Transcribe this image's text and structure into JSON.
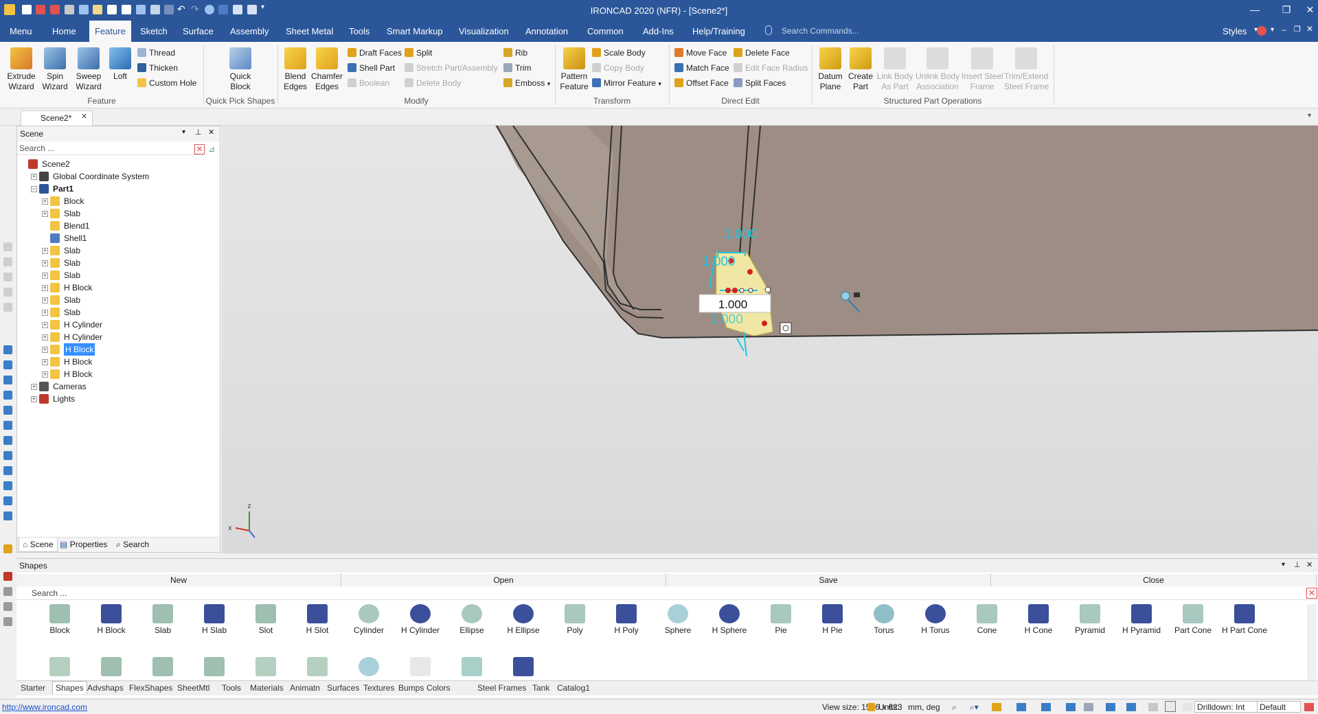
{
  "app": {
    "title": "IRONCAD 2020 (NFR) - [Scene2*]"
  },
  "menu": {
    "tabs": [
      "Menu",
      "Home",
      "Feature",
      "Sketch",
      "Surface",
      "Assembly",
      "Sheet Metal",
      "Tools",
      "Smart Markup",
      "Visualization",
      "Annotation",
      "Common",
      "Add-Ins",
      "Help/Training"
    ],
    "search_placeholder": "Search Commands...",
    "styles_label": "Styles"
  },
  "ribbon": {
    "feature": {
      "extrude": "Extrude\nWizard",
      "spin": "Spin\nWizard",
      "sweep": "Sweep\nWizard",
      "loft": "Loft",
      "thread": "Thread",
      "thicken": "Thicken",
      "custom_hole": "Custom Hole",
      "group": "Feature"
    },
    "quickpick": {
      "quick_block": "Quick\nBlock",
      "group": "Quick Pick Shapes"
    },
    "modify": {
      "blend": "Blend\nEdges",
      "chamfer": "Chamfer\nEdges",
      "draft": "Draft Faces",
      "shell": "Shell Part",
      "boolean": "Boolean",
      "split": "Split",
      "stretch": "Stretch Part/Assembly",
      "delete_body": "Delete Body",
      "rib": "Rib",
      "trim": "Trim",
      "emboss": "Emboss",
      "group": "Modify"
    },
    "transform": {
      "pattern": "Pattern\nFeature",
      "scale": "Scale Body",
      "copy": "Copy Body",
      "mirror": "Mirror Feature",
      "group": "Transform"
    },
    "direct": {
      "move_face": "Move Face",
      "match_face": "Match Face",
      "offset_face": "Offset Face",
      "delete_face": "Delete Face",
      "edit_radius": "Edit Face Radius",
      "split_faces": "Split Faces",
      "group": "Direct Edit"
    },
    "structured": {
      "datum": "Datum\nPlane",
      "create_part": "Create\nPart",
      "link_body": "Link Body\nAs Part",
      "unlink": "Unlink Body\nAssociation",
      "insert_steel": "Insert Steel\nFrame",
      "trim_steel": "Trim/Extend\nSteel Frame",
      "group": "Structured Part Operations"
    }
  },
  "doc_tab": "Scene2*",
  "scene": {
    "title": "Scene",
    "search_placeholder": "Search ...",
    "tree": [
      {
        "label": "Scene2",
        "level": 0
      },
      {
        "label": "Global Coordinate System",
        "level": 1
      },
      {
        "label": "Part1",
        "level": 1
      },
      {
        "label": "Block",
        "level": 2
      },
      {
        "label": "Slab",
        "level": 2
      },
      {
        "label": "Blend1",
        "level": 2
      },
      {
        "label": "Shell1",
        "level": 2
      },
      {
        "label": "Slab",
        "level": 2
      },
      {
        "label": "Slab",
        "level": 2
      },
      {
        "label": "Slab",
        "level": 2
      },
      {
        "label": "H Block",
        "level": 2
      },
      {
        "label": "Slab",
        "level": 2
      },
      {
        "label": "Slab",
        "level": 2
      },
      {
        "label": "H Cylinder",
        "level": 2
      },
      {
        "label": "H Cylinder",
        "level": 2
      },
      {
        "label": "H Block",
        "level": 2
      },
      {
        "label": "H Block",
        "level": 2
      },
      {
        "label": "H Block",
        "level": 2
      },
      {
        "label": "Cameras",
        "level": 1
      },
      {
        "label": "Lights",
        "level": 1
      }
    ],
    "bottom_tabs": [
      "Scene",
      "Properties",
      "Search"
    ]
  },
  "viewport": {
    "dim_top": "1.000",
    "dim_left": "1.000",
    "dim_input": "1.000",
    "dim_under": "1.000",
    "axis_x": "x",
    "axis_z": "z"
  },
  "shapes": {
    "title": "Shapes",
    "buttons": [
      "New",
      "Open",
      "Save",
      "Close"
    ],
    "search_placeholder": "Search ...",
    "items": [
      "Block",
      "H Block",
      "Slab",
      "H Slab",
      "Slot",
      "H Slot",
      "Cylinder",
      "H Cylinder",
      "Ellipse",
      "H Ellipse",
      "Poly",
      "H Poly",
      "Sphere",
      "H Sphere",
      "Pie",
      "H Pie",
      "Torus",
      "H Torus",
      "Cone",
      "H Cone",
      "Pyramid",
      "H Pyramid",
      "Part Cone",
      "H Part Cone"
    ],
    "catalogs": [
      "Starter",
      "Shapes",
      "Advshaps",
      "FlexShapes",
      "SheetMtl",
      "Tools",
      "Materials",
      "Animatn",
      "Surfaces",
      "Textures",
      "Bumps",
      "Colors",
      "Steel Frames",
      "Tank",
      "Catalog1"
    ]
  },
  "status": {
    "url": "http://www.ironcad.com",
    "view_size": "View size: 1596 x  623",
    "units_label": "Units:",
    "units_value": "mm, deg",
    "drilldown": "Drilldown: Int",
    "default": "Default"
  }
}
